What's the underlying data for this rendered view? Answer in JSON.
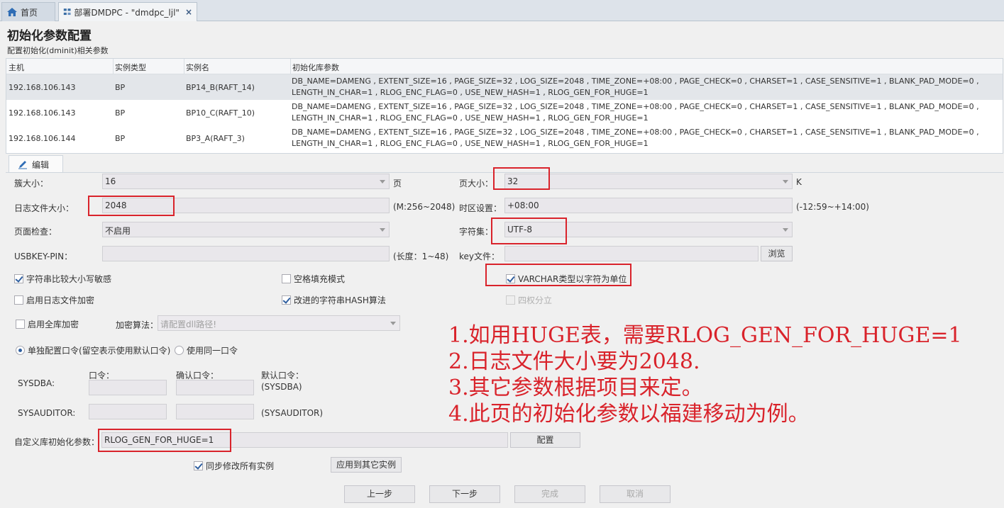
{
  "tabs": [
    {
      "label": "首页",
      "icon": "home-icon"
    },
    {
      "label": "部署DMDPC - \"dmdpc_ljl\"",
      "icon": "deploy-icon",
      "close": "×"
    }
  ],
  "page": {
    "title": "初始化参数配置",
    "subtitle": "配置初始化(dminit)相关参数"
  },
  "table": {
    "headers": [
      "主机",
      "实例类型",
      "实例名",
      "初始化库参数"
    ],
    "rows": [
      {
        "host": "192.168.106.143",
        "type": "BP",
        "name": "BP14_B(RAFT_14)",
        "params1": "DB_NAME=DAMENG , EXTENT_SIZE=16 , PAGE_SIZE=32 , LOG_SIZE=2048 , TIME_ZONE=+08:00 , PAGE_CHECK=0 , CHARSET=1 , CASE_SENSITIVE=1 , BLANK_PAD_MODE=0 ,",
        "params2": "LENGTH_IN_CHAR=1 , RLOG_ENC_FLAG=0 , USE_NEW_HASH=1 , RLOG_GEN_FOR_HUGE=1"
      },
      {
        "host": "192.168.106.143",
        "type": "BP",
        "name": "BP10_C(RAFT_10)",
        "params1": "DB_NAME=DAMENG , EXTENT_SIZE=16 , PAGE_SIZE=32 , LOG_SIZE=2048 , TIME_ZONE=+08:00 , PAGE_CHECK=0 , CHARSET=1 , CASE_SENSITIVE=1 , BLANK_PAD_MODE=0 ,",
        "params2": "LENGTH_IN_CHAR=1 , RLOG_ENC_FLAG=0 , USE_NEW_HASH=1 , RLOG_GEN_FOR_HUGE=1"
      },
      {
        "host": "192.168.106.144",
        "type": "BP",
        "name": "BP3_A(RAFT_3)",
        "params1": "DB_NAME=DAMENG , EXTENT_SIZE=16 , PAGE_SIZE=32 , LOG_SIZE=2048 , TIME_ZONE=+08:00 , PAGE_CHECK=0 , CHARSET=1 , CASE_SENSITIVE=1 , BLANK_PAD_MODE=0 ,",
        "params2": "LENGTH_IN_CHAR=1 , RLOG_ENC_FLAG=0 , USE_NEW_HASH=1 , RLOG_GEN_FOR_HUGE=1"
      }
    ]
  },
  "edit_tab": {
    "label": "编辑",
    "icon": "pencil-icon"
  },
  "form": {
    "extent_label": "簇大小：",
    "extent_value": "16",
    "extent_unit": "页",
    "page_size_label": "页大小：",
    "page_size_value": "32",
    "page_size_unit": "K",
    "log_size_label": "日志文件大小：",
    "log_size_value": "2048",
    "log_size_hint": "(M:256~2048)",
    "timezone_label": "时区设置：",
    "timezone_value": "+08:00",
    "timezone_hint": "(-12:59~+14:00)",
    "page_check_label": "页面检查：",
    "page_check_value": "不启用",
    "charset_label": "字符集：",
    "charset_value": "UTF-8",
    "usbkey_label": "USBKEY-PIN：",
    "usbkey_value": "",
    "usbkey_hint": "(长度：1~48)",
    "keyfile_label": "key文件：",
    "keyfile_value": "",
    "browse_label": "浏览",
    "case_sensitive_label": "字符串比较大小写敏感",
    "case_sensitive_checked": true,
    "blank_pad_label": "空格填充模式",
    "blank_pad_checked": false,
    "length_in_char_label": "VARCHAR类型以字符为单位",
    "length_in_char_checked": true,
    "log_encrypt_label": "启用日志文件加密",
    "log_encrypt_checked": false,
    "new_hash_label": "改进的字符串HASH算法",
    "new_hash_checked": true,
    "four_power_label": "四权分立",
    "four_power_checked": false,
    "db_encrypt_label": "启用全库加密",
    "db_encrypt_checked": false,
    "encrypt_algo_label": "加密算法：",
    "encrypt_algo_placeholder": "请配置dll路径!",
    "radio_separate_label": "单独配置口令(留空表示使用默认口令)",
    "radio_same_label": "使用同一口令",
    "password_label": "口令：",
    "confirm_label": "确认口令：",
    "default_label": "默认口令：",
    "sysdba_label": "SYSDBA:",
    "sysdba_default": "(SYSDBA)",
    "sysauditor_label": "SYSAUDITOR:",
    "sysauditor_default": "(SYSAUDITOR)",
    "custom_label": "自定义库初始化参数：",
    "custom_value": "RLOG_GEN_FOR_HUGE=1",
    "config_button": "配置",
    "sync_label": "同步修改所有实例",
    "sync_checked": true,
    "apply_button": "应用到其它实例"
  },
  "footer": {
    "prev": "上一步",
    "next": "下一步",
    "finish": "完成",
    "cancel": "取消"
  },
  "annotation": [
    "1.如用HUGE表，需要RLOG_GEN_FOR_HUGE=1",
    "2.日志文件大小要为2048.",
    "3.其它参数根据项目来定。",
    "4.此页的初始化参数以福建移动为例。"
  ],
  "colors": {
    "highlight": "#d9232b",
    "accent": "#2f5f9f"
  }
}
